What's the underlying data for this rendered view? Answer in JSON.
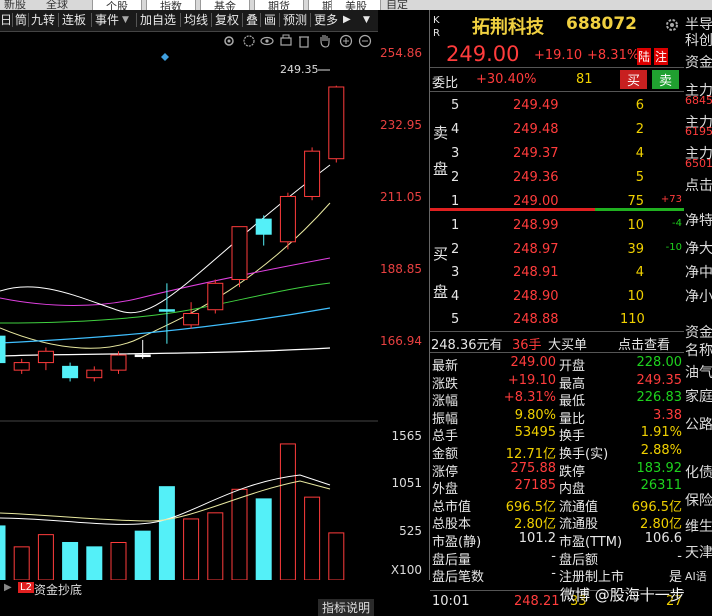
{
  "top_strip": [
    "新股",
    "全球",
    "个股",
    "指数",
    "基金",
    "期货",
    "期权",
    "美股",
    "自定"
  ],
  "toolbar": {
    "items": [
      "日",
      "筒",
      "九转",
      "连板",
      "事件",
      "加自选",
      "均线",
      "复权",
      "叠",
      "画",
      "预测",
      "更多"
    ],
    "arrows": [
      "▶",
      "▼"
    ]
  },
  "chart_icons": [
    "gear-icon",
    "eye-icon",
    "print-icon",
    "hand-icon",
    "zoom-in-icon",
    "zoom-out-icon"
  ],
  "price_axis": [
    "254.86",
    "232.95",
    "211.05",
    "188.85",
    "166.94"
  ],
  "volume_axis": [
    "1565",
    "1051",
    "525",
    "X100"
  ],
  "max_price_label": "249.35",
  "chart_data": {
    "type": "candlestick",
    "ylim": [
      160.0,
      258.0
    ],
    "candles": [
      {
        "o": 183,
        "c": 176,
        "h": 183,
        "l": 175,
        "color": "cyan"
      },
      {
        "o": 174,
        "c": 176,
        "h": 177,
        "l": 173,
        "color": "red"
      },
      {
        "o": 176,
        "c": 179,
        "h": 180,
        "l": 174,
        "color": "red"
      },
      {
        "o": 175,
        "c": 172,
        "h": 176,
        "l": 171,
        "color": "cyan"
      },
      {
        "o": 172,
        "c": 174,
        "h": 175,
        "l": 171,
        "color": "red"
      },
      {
        "o": 174,
        "c": 178,
        "h": 179,
        "l": 173,
        "color": "red"
      },
      {
        "o": 178,
        "c": 178,
        "h": 182,
        "l": 177,
        "color": "white"
      },
      {
        "o": 190,
        "c": 190,
        "h": 197,
        "l": 181,
        "color": "cyan"
      },
      {
        "o": 186,
        "c": 189,
        "h": 192,
        "l": 185,
        "color": "red"
      },
      {
        "o": 190,
        "c": 197,
        "h": 198,
        "l": 189,
        "color": "red"
      },
      {
        "o": 198,
        "c": 212,
        "h": 212,
        "l": 196,
        "color": "red"
      },
      {
        "o": 214,
        "c": 210,
        "h": 215,
        "l": 207,
        "color": "cyan"
      },
      {
        "o": 208,
        "c": 220,
        "h": 221,
        "l": 206,
        "color": "red"
      },
      {
        "o": 220,
        "c": 232,
        "h": 233,
        "l": 219,
        "color": "red"
      },
      {
        "o": 230,
        "c": 249,
        "h": 249.35,
        "l": 229,
        "color": "red"
      }
    ],
    "volumes": [
      {
        "v": 620,
        "color": "cyan"
      },
      {
        "v": 0,
        "color": "none"
      },
      {
        "v": 0,
        "color": "none"
      },
      {
        "v": 430,
        "color": "cyan"
      },
      {
        "v": 380,
        "color": "cyan"
      },
      {
        "v": 0,
        "color": "none"
      },
      {
        "v": 560,
        "color": "cyan"
      },
      {
        "v": 1070,
        "color": "cyan"
      },
      {
        "v": 0,
        "color": "none"
      },
      {
        "v": 0,
        "color": "none"
      },
      {
        "v": 1040,
        "color": "red"
      },
      {
        "v": 930,
        "color": "cyan"
      },
      {
        "v": 0,
        "color": "none"
      },
      {
        "v": 0,
        "color": "none"
      },
      {
        "v": 540,
        "color": "red"
      }
    ]
  },
  "bottom_tabs": {
    "l2": "L2",
    "capital": "资金抄底",
    "indicator": "指标说明"
  },
  "stock": {
    "name": "拓荆科技",
    "code": "688072",
    "price": "249.00",
    "change": "+19.10",
    "change_pct": "+8.31%",
    "board": "陆",
    "board2": "注",
    "kr": "K\nR"
  },
  "webi": {
    "label": "委比",
    "value": "+30.40%",
    "diff": "81",
    "buy": "买",
    "sell": "卖"
  },
  "sell_side_label": [
    "卖",
    "盘"
  ],
  "buy_side_label": [
    "买",
    "盘"
  ],
  "asks": [
    {
      "lvl": "5",
      "price": "249.49",
      "vol": "6",
      "chg": ""
    },
    {
      "lvl": "4",
      "price": "249.48",
      "vol": "2",
      "chg": ""
    },
    {
      "lvl": "3",
      "price": "249.37",
      "vol": "4",
      "chg": ""
    },
    {
      "lvl": "2",
      "price": "249.36",
      "vol": "5",
      "chg": ""
    },
    {
      "lvl": "1",
      "price": "249.00",
      "vol": "75",
      "chg": "+73"
    }
  ],
  "bids": [
    {
      "lvl": "1",
      "price": "248.99",
      "vol": "10",
      "chg": "-4"
    },
    {
      "lvl": "2",
      "price": "248.97",
      "vol": "39",
      "chg": "-10"
    },
    {
      "lvl": "3",
      "price": "248.91",
      "vol": "4",
      "chg": ""
    },
    {
      "lvl": "4",
      "price": "248.90",
      "vol": "10",
      "chg": ""
    },
    {
      "lvl": "5",
      "price": "248.88",
      "vol": "110",
      "chg": ""
    }
  ],
  "last_trade": {
    "price": "248.36元有",
    "hands": "36手",
    "big": "大买单",
    "check": "点击查看"
  },
  "details": [
    {
      "k1": "最新",
      "v1": "249.00",
      "c1": "red",
      "k2": "开盘",
      "v2": "228.00",
      "c2": "green"
    },
    {
      "k1": "涨跌",
      "v1": "+19.10",
      "c1": "red",
      "k2": "最高",
      "v2": "249.35",
      "c2": "red"
    },
    {
      "k1": "涨幅",
      "v1": "+8.31%",
      "c1": "red",
      "k2": "最低",
      "v2": "226.83",
      "c2": "green"
    },
    {
      "k1": "振幅",
      "v1": "9.80%",
      "c1": "yellow",
      "k2": "量比",
      "v2": "3.38",
      "c2": "red"
    },
    {
      "k1": "总手",
      "v1": "53495",
      "c1": "yellow",
      "k2": "换手",
      "v2": "1.91%",
      "c2": "yellow"
    },
    {
      "k1": "金额",
      "v1": "12.71亿",
      "c1": "yellow",
      "k2": "换手(实)",
      "v2": "2.88%",
      "c2": "yellow"
    },
    {
      "k1": "涨停",
      "v1": "275.88",
      "c1": "red",
      "k2": "跌停",
      "v2": "183.92",
      "c2": "green"
    },
    {
      "k1": "外盘",
      "v1": "27185",
      "c1": "red",
      "k2": "内盘",
      "v2": "26311",
      "c2": "green"
    },
    {
      "k1": "总市值",
      "v1": "696.5亿",
      "c1": "yellow",
      "k2": "流通值",
      "v2": "696.5亿",
      "c2": "yellow"
    },
    {
      "k1": "总股本",
      "v1": "2.80亿",
      "c1": "yellow",
      "k2": "流通股",
      "v2": "2.80亿",
      "c2": "yellow"
    },
    {
      "k1": "市盈(静)",
      "v1": "101.2",
      "c1": "white",
      "k2": "市盈(TTM)",
      "v2": "106.6",
      "c2": "white"
    },
    {
      "k1": "盘后量",
      "v1": "-",
      "c1": "white",
      "k2": "盘后额",
      "v2": "-",
      "c2": "white"
    },
    {
      "k1": "盘后笔数",
      "v1": "-",
      "c1": "white",
      "k2": "注册制上市",
      "v2": "是",
      "c2": "white"
    }
  ],
  "tick": {
    "time": "10:01",
    "price": "248.21",
    "vol": "33",
    "vol2": "27"
  },
  "watermark": "微博 @股海十一步",
  "far_right": [
    "半导",
    "科创",
    "资金",
    "主力",
    "6845",
    "主力",
    "6195",
    "主力",
    "6501",
    "点击",
    "净特",
    "净大",
    "净中",
    "净小",
    "资金",
    "名称",
    "油气",
    "家庭",
    "公路",
    "化债",
    "保险",
    "维生",
    "天津",
    "AI语"
  ]
}
